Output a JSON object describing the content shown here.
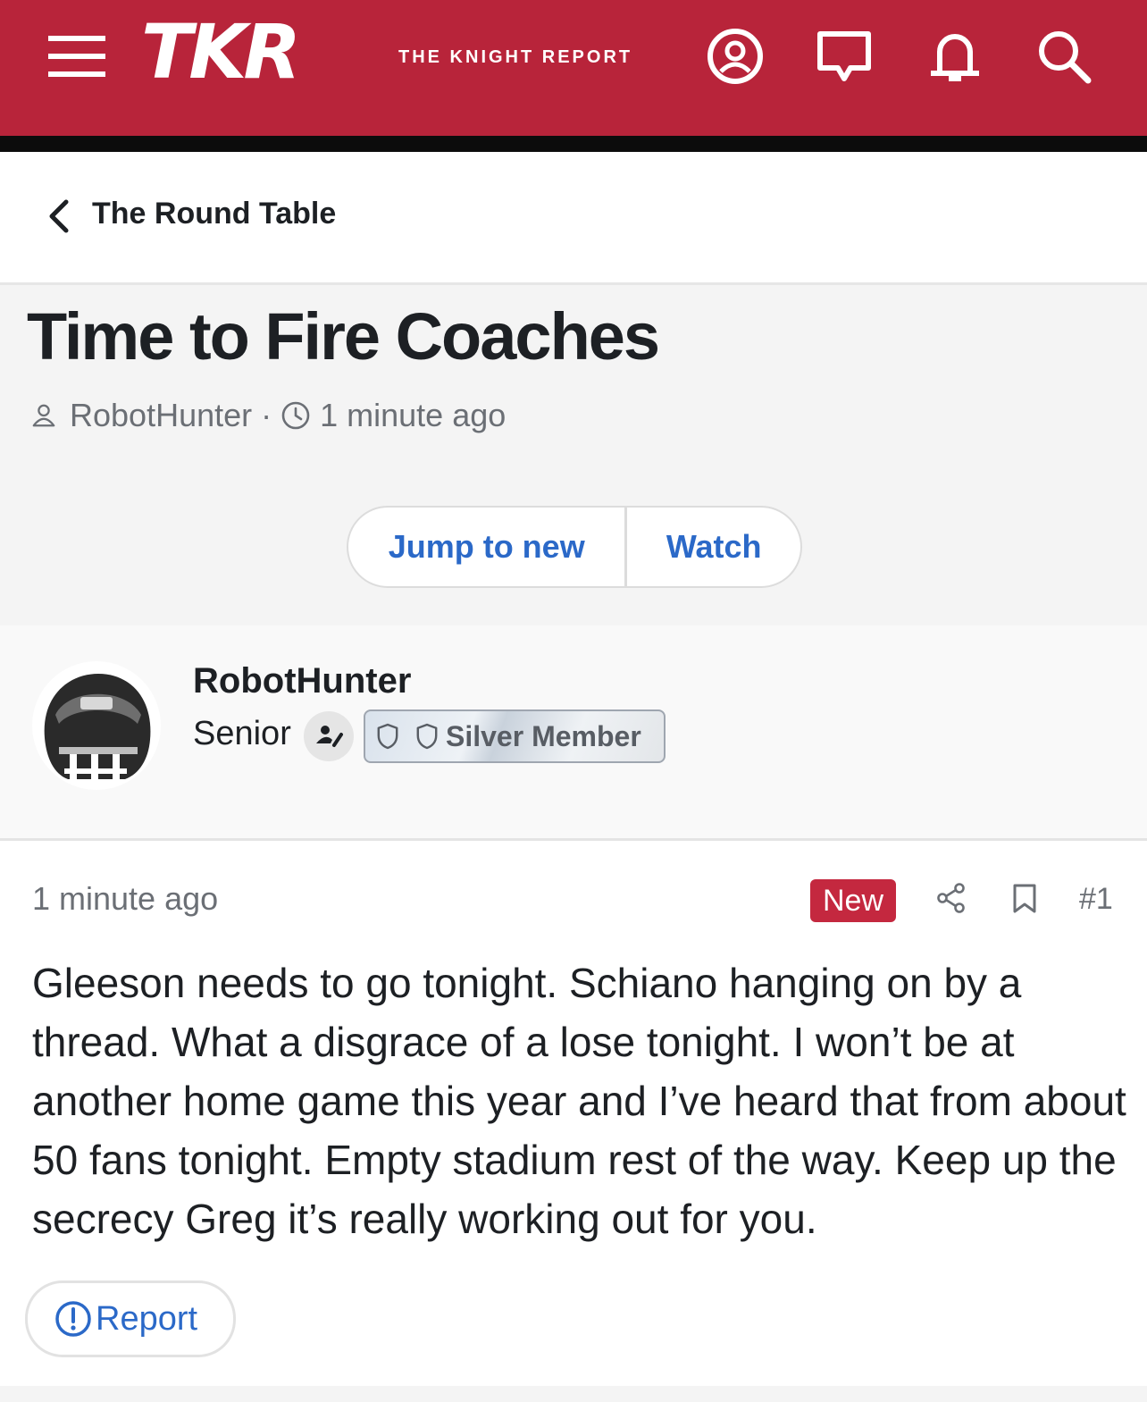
{
  "header": {
    "logo_text": "TKR",
    "logo_tagline": "THE KNIGHT REPORT",
    "brand_color": "#b8243a",
    "icons": [
      "menu-icon",
      "account-icon",
      "conversations-icon",
      "alerts-icon",
      "search-icon"
    ]
  },
  "breadcrumb": {
    "label": "The Round Table"
  },
  "thread": {
    "title": "Time to Fire Coaches",
    "author": "RobotHunter",
    "separator": "·",
    "posted": "1 minute ago"
  },
  "actions": {
    "jump_label": "Jump to new",
    "watch_label": "Watch"
  },
  "author_panel": {
    "name": "RobotHunter",
    "rank": "Senior",
    "badge": "Silver Member"
  },
  "post": {
    "time": "1 minute ago",
    "new_badge": "New",
    "number": "#1",
    "body": "Gleeson needs to go tonight. Schiano hanging on by a thread. What a disgrace of a lose tonight. I won’t be at another home game this year and I’ve heard that from about 50 fans tonight. Empty stadium rest of the way. Keep up the secrecy Greg it’s really working out for you.",
    "report_label": "Report"
  },
  "colors": {
    "link": "#2b69c8",
    "new_badge": "#c4283f",
    "text": "#1d2024",
    "muted": "#6b6f75"
  }
}
